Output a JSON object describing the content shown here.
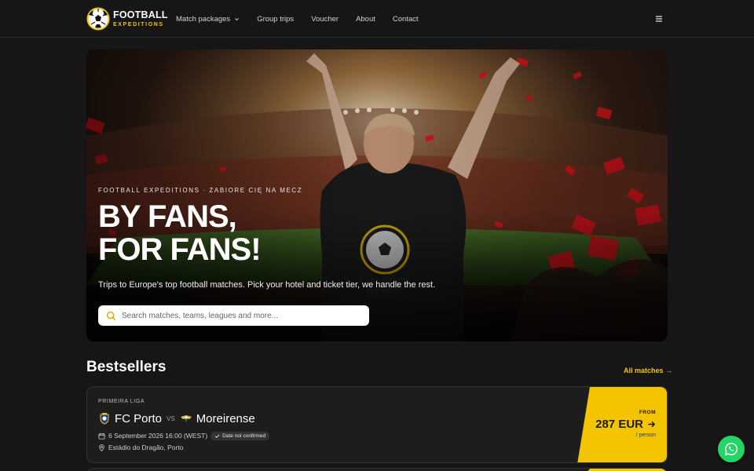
{
  "brand": {
    "name_top": "FOOTBALL",
    "name_bottom": "EXPEDITIONS"
  },
  "nav": [
    {
      "label": "Match packages",
      "dropdown": true
    },
    {
      "label": "Group trips"
    },
    {
      "label": "Voucher"
    },
    {
      "label": "About"
    },
    {
      "label": "Contact"
    }
  ],
  "hero": {
    "tagline": "FOOTBALL EXPEDITIONS · ZABIORE CIĘ NA MECZ",
    "title_line1": "BY FANS,",
    "title_line2": "FOR FANS!",
    "subtitle": "Trips to Europe's top football matches. Pick your hotel and ticket tier, we handle the rest.",
    "search_placeholder": "Search matches, teams, leagues and more..."
  },
  "bestsellers": {
    "heading": "Bestsellers",
    "all_link": "All matches →",
    "items": [
      {
        "league": "PRIMEIRA LIGA",
        "home": "FC Porto",
        "vs": "VS",
        "away": "Moreirense",
        "datetime": "6 September 2026 16:00 (WEST)",
        "badge": "Date not confirmed",
        "venue": "Estádio do Dragão, Porto",
        "from_label": "FROM",
        "price": "287 EUR",
        "per": "/ person"
      }
    ]
  },
  "colors": {
    "accent": "#f5c400",
    "background": "#161616",
    "card": "#1d1d1d",
    "whatsapp": "#25d366"
  },
  "icons": [
    "soccer-ball-logo",
    "chevron-down-icon",
    "hamburger-menu-icon",
    "search-icon",
    "calendar-icon",
    "check-icon",
    "location-pin-icon",
    "arrow-right-icon",
    "whatsapp-icon"
  ]
}
